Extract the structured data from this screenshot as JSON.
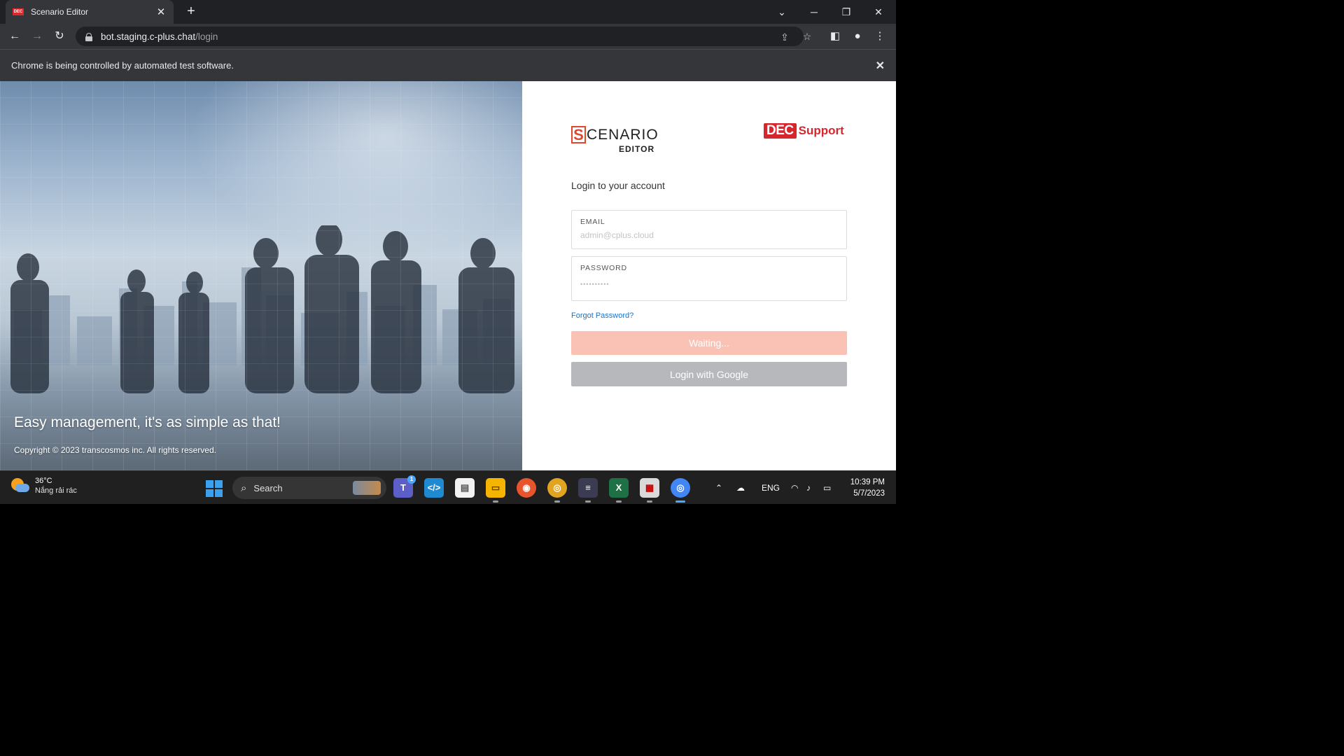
{
  "browser": {
    "tab_title": "Scenario Editor",
    "tab_favicon_text": "DEC",
    "url_host": "bot.staging.c-plus.chat",
    "url_path": "/login",
    "infobar_text": "Chrome is being controlled by automated test software."
  },
  "page": {
    "hero_tagline": "Easy management, it's as simple as that!",
    "copyright": "Copyright © 2023 transcosmos inc. All rights reserved.",
    "logo_left": {
      "letter": "S",
      "rest": "CENARIO",
      "sub": "EDITOR"
    },
    "logo_right": {
      "box_text": "DEC",
      "text": "Support"
    },
    "heading": "Login to your account",
    "email": {
      "label": "EMAIL",
      "placeholder": "admin@cplus.cloud"
    },
    "password": {
      "label": "PASSWORD",
      "value": "••••••••••"
    },
    "forgot_password": "Forgot Password?",
    "submit_label": "Waiting...",
    "google_label": "Login with Google",
    "colors": {
      "accent": "#e0472c",
      "brand_red": "#d6262e",
      "submit_disabled": "#f9c2b5",
      "google_disabled": "#b7b8bb",
      "link": "#1a73c9"
    }
  },
  "taskbar": {
    "weather_temp": "36°C",
    "weather_desc": "Nắng rải rác",
    "search_label": "Search",
    "apps": [
      "teams-icon",
      "vscode-icon",
      "notepad-icon",
      "file-explorer-icon",
      "firefox-icon",
      "chrome-canary-icon",
      "terminal-icon",
      "excel-icon",
      "calendar-icon",
      "chrome-icon"
    ],
    "teams_badge": "1",
    "language": "ENG",
    "time": "10:39 PM",
    "date": "5/7/2023"
  }
}
